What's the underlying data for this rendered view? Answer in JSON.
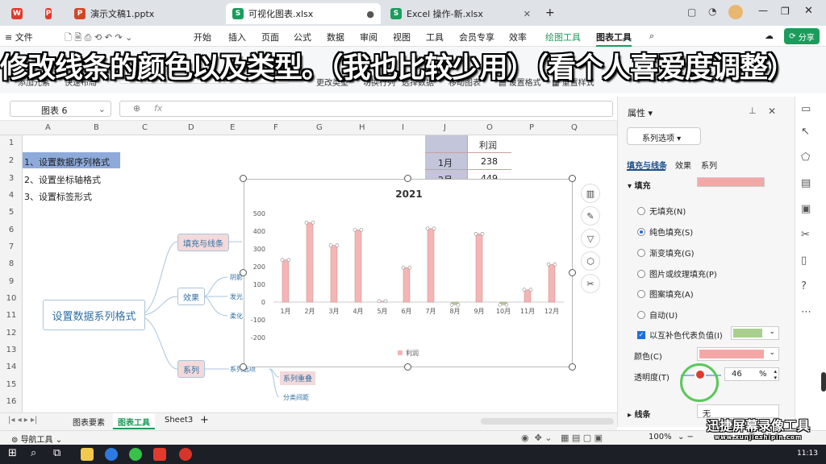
{
  "tabs": [
    {
      "label": "",
      "icon": "wps-icon"
    },
    {
      "label": "",
      "icon": "pdf-icon"
    },
    {
      "label": "演示文稿1.pptx"
    },
    {
      "label": "可视化图表.xlsx"
    },
    {
      "label": "Excel 操作-新.xlsx"
    }
  ],
  "menu": {
    "file": "文件",
    "items": [
      "开始",
      "插入",
      "页面",
      "公式",
      "数据",
      "审阅",
      "视图",
      "工具",
      "会员专享",
      "效率"
    ],
    "draw_tools": "绘图工具",
    "chart_tools": "图表工具",
    "share": "分享"
  },
  "overlay_caption": "修改线条的颜色以及类型。（我也比较少用）（看个人喜爱度调整）",
  "toolbar": {
    "add_element": "添加元素",
    "quick_layout": "快速布局",
    "change_type": "更改类型",
    "switch_row_col": "切换行列",
    "select_data": "选择数据",
    "move_chart": "移动图表",
    "set_format": "设置格式",
    "reset_style": "重置样式"
  },
  "namebox": "图表 6",
  "fx": "fx",
  "columns": [
    "A",
    "B",
    "C",
    "D",
    "E",
    "F",
    "G",
    "H",
    "I",
    "J",
    "O",
    "P",
    "Q"
  ],
  "rows": [
    "1",
    "2",
    "3",
    "4",
    "5",
    "6",
    "7",
    "8",
    "9",
    "10",
    "11",
    "12",
    "13",
    "14",
    "15",
    "16"
  ],
  "cells": {
    "a2": "1、设置数据序列格式",
    "a3": "2、设置坐标轴格式",
    "a4": "3、设置标签形式",
    "o1": "利润",
    "j2": "1月",
    "o2": "238",
    "j3": "2月",
    "o3": "449"
  },
  "mindmap": {
    "root": "设置数据系列格式",
    "fill": "填充与线条",
    "effect": "效果",
    "series": "系列",
    "effect_children": [
      "阴影",
      "发光",
      "柔化"
    ],
    "series_children": [
      "系列选项",
      "系列重叠",
      "分类间距"
    ]
  },
  "chart_data": {
    "type": "bar",
    "title": "2021",
    "categories": [
      "1月",
      "2月",
      "3月",
      "4月",
      "5月",
      "6月",
      "7月",
      "8月",
      "9月",
      "10月",
      "11月",
      "12月"
    ],
    "series": [
      {
        "name": "利润",
        "values": [
          238,
          449,
          320,
          408,
          5,
          195,
          415,
          -15,
          385,
          -15,
          70,
          213
        ]
      }
    ],
    "ylim": [
      -200,
      500
    ],
    "yticks": [
      "500",
      "400",
      "300",
      "200",
      "100",
      "0",
      "-100",
      "-200"
    ],
    "bar_color": "#f5b5b5",
    "invert_color": "#a9d08e",
    "legend_position": "bottom"
  },
  "panel": {
    "title": "属性",
    "series_options": "系列选项",
    "tabs": [
      "填充与线条",
      "效果",
      "系列"
    ],
    "fill_header": "填充",
    "options": [
      "无填充(N)",
      "纯色填充(S)",
      "渐变填充(G)",
      "图片或纹理填充(P)",
      "图案填充(A)",
      "自动(U)"
    ],
    "invert": "以互补色代表负值(I)",
    "color_label": "颜色(C)",
    "transparency_label": "透明度(T)",
    "transparency_value": "46",
    "percent": "%",
    "line_header": "线条",
    "line_value": "无",
    "fill_color": "#f5a7a7",
    "invert_swatch": "#a9d08e"
  },
  "sheets": [
    "图表要素",
    "图表工具",
    "Sheet3"
  ],
  "status": {
    "nav": "导航工具",
    "zoom": "100%"
  },
  "taskbar": {
    "time": "11:13"
  },
  "watermark": {
    "line1": "迅捷屏幕录像工具",
    "line2": "www.xunjieshipin.com"
  }
}
